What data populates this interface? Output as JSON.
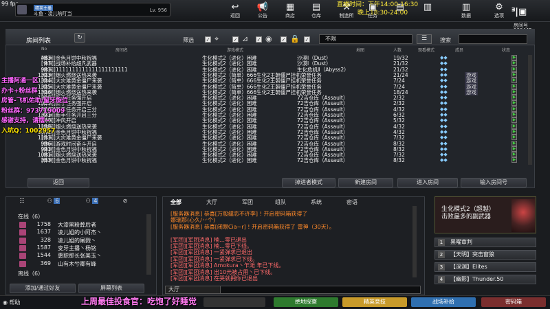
{
  "overlay": {
    "fps": "99 fps",
    "stream_time_1": "直播时间：下午14:00-16:30",
    "stream_time_2": "晚上18:30-24:00",
    "streamer_lines": [
      "主播阿通一区",
      "办卡+粉丝群",
      "房管-飞机佑助/留牙旋位",
      "粉丝群：973719009",
      "感谢支持，请摆~",
      "入坑Q：1002957"
    ],
    "bottom_banner": "上周最佳投食官：吃饱了好睡觉"
  },
  "player": {
    "tag": "精英主播",
    "name": "斗鱼 · 凌儿呐叮当",
    "level": "Lv. 956"
  },
  "nav": [
    {
      "label": "返回",
      "icon": "↩"
    },
    {
      "label": "公告",
      "icon": "📢"
    },
    {
      "label": "商店",
      "icon": "▦"
    },
    {
      "label": "仓库",
      "icon": "▤"
    },
    {
      "label": "制造所",
      "icon": "⚒"
    },
    {
      "label": "任务",
      "icon": "▣"
    },
    {
      "label": "",
      "icon": "▤"
    },
    {
      "label": "",
      "icon": "▥"
    },
    {
      "label": "数据",
      "icon": "▥"
    },
    {
      "label": "选项",
      "icon": "⚙"
    }
  ],
  "logo": {
    "label": "房间号",
    "number": "100445"
  },
  "room": {
    "title": "房间列表",
    "filter_label": "筛选",
    "filter_value": "不限",
    "search_label": "搜索",
    "columns": [
      "No",
      "房间名",
      "游戏模式",
      "地图",
      "人数",
      "观看模式",
      "成员",
      "状态"
    ],
    "rows": [
      [
        "463",
        "[休闲]金色月饼中秋祝福",
        "生化模式2（进化）困难",
        "沙漠Ⅰ（Dust）",
        "19/32",
        ""
      ],
      [
        "97",
        "[休闲]战场补给超凡武器",
        "生化模式2（进化）困难",
        "沙漠Ⅰ（Dust）",
        "21/32",
        ""
      ],
      [
        "983",
        "[休闲]1111111111111111111111",
        "生化模式2（进化）困难",
        "生化危机Ⅱ（Abyss2）",
        "21/32",
        ""
      ],
      [
        "1313",
        "[休闲]烟火燃烧送热来袭",
        "生化模式2（简单）666生化2王朝僵尸挂机荣誉任务",
        "",
        "21/24",
        "游戏"
      ],
      [
        "1314",
        "[休闲]大灾难黄金僵尸来袭",
        "生化模式2（简单）666生化2王朝僵尸挂机荣誉任务",
        "",
        "7/24",
        "游戏"
      ],
      [
        "1315",
        "[休闲]大灾难黄金僵尸来袭",
        "生化模式2（简单）666生化2王朝僵尸挂机荣誉任务",
        "",
        "7/24",
        "游戏"
      ],
      [
        "1316",
        "[休闲]烟火燃烧送热来袭",
        "生化模式2（简单）666生化2王朝僵尸挂机荣誉任务",
        "",
        "18/24",
        "游戏"
      ],
      [
        "1318",
        "[休闲]新手任务强开启",
        "生化模式2（进化）困难",
        "72吉仓库（Assault）",
        "2/32",
        ""
      ],
      [
        "1319",
        "[休闲]新手任务强开启",
        "生化模式2（进化）困难",
        "72吉仓库（Assault）",
        "2/32",
        ""
      ],
      [
        "1366",
        "[休闲]新手任务开启三分",
        "生化模式2（进化）困难",
        "72吉仓库（Assault）",
        "4/32",
        ""
      ],
      [
        "1371",
        "[休闲]新手任务开启三分",
        "生化模式2（进化）困难",
        "72吉仓库（Assault）",
        "6/32",
        ""
      ],
      [
        "1360",
        "[休闲]冲风开启",
        "生化模式2（进化）困难",
        "72吉仓库（Assault）",
        "5/32",
        ""
      ],
      [
        "1158",
        "[休闲]烟火燃烧送热来袭",
        "生化模式2（进化）困难",
        "72吉仓库（Assault）",
        "4/32",
        ""
      ],
      [
        "1041",
        "[休闲]金色月饼中秋祝福",
        "生化模式2（进化）困难",
        "72吉仓库（Assault）",
        "4/32",
        ""
      ],
      [
        "1153",
        "[休闲]大灾难黄金僵尸来袭",
        "生化模式2（进化）困难",
        "72吉仓库（Assault）",
        "7/32",
        ""
      ],
      [
        "996",
        "[休闲]游戏时间奋斗开启",
        "生化模式2（进化）困难",
        "72吉仓库（Assault）",
        "8/32",
        ""
      ],
      [
        "991",
        "[休闲]金色月饼中秋祝福",
        "生化模式2（进化）困难",
        "72吉仓库（Assault）",
        "8/32",
        ""
      ],
      [
        "1081",
        "[休闲]烟火燃烧送热来袭",
        "生化模式2（进化）困难",
        "72吉仓库（Assault）",
        "7/32",
        ""
      ],
      [
        "353",
        "[休闲]金色月饼中秋祝福",
        "生化模式2（进化）困难",
        "72吉仓库（Assault）",
        "8/32",
        ""
      ]
    ],
    "buttons": {
      "back": "返回",
      "observer": "掉进者模式",
      "new_room": "新建房间",
      "enter": "进入房间",
      "enter_number": "输入房间号"
    }
  },
  "friends": {
    "tab_counts": [
      "",
      "6",
      "4",
      ""
    ],
    "online_label": "在线（6）",
    "offline_label": "离线（6）",
    "online": [
      [
        "1758",
        "大漆黑粉葬后者"
      ],
      [
        "1637",
        "凌儿姐的小阿杰丶"
      ],
      [
        "328",
        "凌儿姐的屠戮丶"
      ],
      [
        "1587",
        "变牙主播丶杨铭"
      ],
      [
        "1544",
        "惠职那长张美玉丶"
      ],
      [
        "369",
        "山有木兮卿有峰"
      ]
    ],
    "add_button": "添加/通过好友",
    "block_button": "屏幕列表"
  },
  "chat": {
    "tabs": [
      "全部",
      "大厅",
      "军团",
      "组队",
      "系统",
      "密语",
      ""
    ],
    "lines": [
      {
        "text": "[服务器消息] 恭喜[万般缱恋不许李] ! 开启密码箱获得了",
        "color": "#ff8a2a"
      },
      {
        "text": "娜瑞那(心久/丷个)",
        "color": "#ff8a2a"
      },
      {
        "text": "[服务器消息] 恭喜[闭眼Cia~r] ! 开启密码箱获得了 雷神（30天）。",
        "color": "#ff8a2a"
      },
      {
        "text": "",
        "color": "#ff8a2a"
      },
      {
        "text": "[军团][军团消息] 楠…零已退出",
        "color": "#ff6a6a"
      },
      {
        "text": "[军团][军团消息] 楠…零已下线。",
        "color": "#ff6a6a"
      },
      {
        "text": "[军团][军团消息] 一紧弹求已退出",
        "color": "#ff6a6a"
      },
      {
        "text": "[军团][军团消息] 一紧弹求已下线。",
        "color": "#ff6a6a"
      },
      {
        "text": "[军团][军团消息] Amokura丶乍滩 年已下线。",
        "color": "#ff6a6a"
      },
      {
        "text": "[军团][军团消息] 出10元被占用丶已下线。",
        "color": "#ff6a6a"
      },
      {
        "text": "[军团][军团消息] 在哭就拥你已退出",
        "color": "#ff6a6a"
      }
    ],
    "channel": "大厅"
  },
  "mode_panel": {
    "title_1": "生化模式2（超越）",
    "title_2": "击败最多的副武器"
  },
  "rank_list": [
    [
      "1",
      "黑曜审判"
    ],
    [
      "2",
      "【天明】突击窗狼"
    ],
    [
      "3",
      "【深渊】Elites"
    ],
    [
      "4",
      "【幽影】Thunder.50"
    ]
  ],
  "bottom": {
    "help": "帮助",
    "buttons": [
      "",
      "绝地探察",
      "精英竞技",
      "战场补给",
      "密码箱"
    ]
  }
}
